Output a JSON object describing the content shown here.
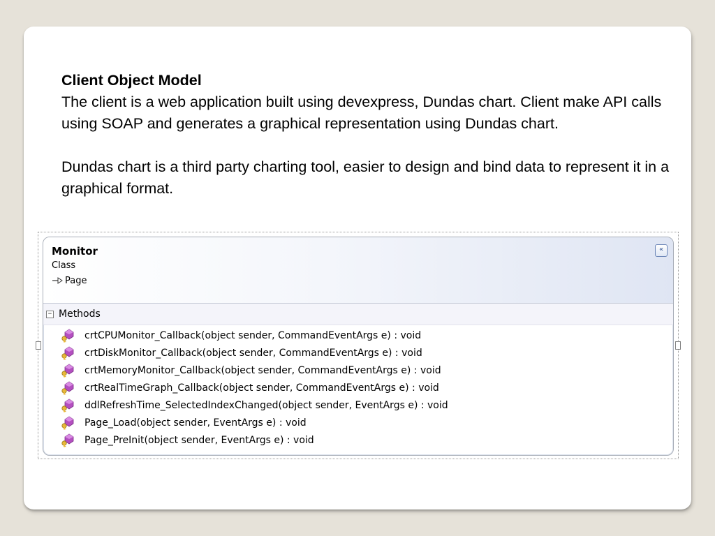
{
  "slide": {
    "heading": "Client Object Model",
    "paragraph1": "The client is a web application built using devexpress, Dundas chart. Client make API calls using SOAP and generates a graphical representation using Dundas chart.",
    "paragraph2": "Dundas chart is a third party charting tool, easier to design and bind data to represent it in a graphical format."
  },
  "diagram": {
    "class_name": "Monitor",
    "class_kind": "Class",
    "base_class": "Page",
    "collapse_glyph": "«",
    "section_label": "Methods",
    "methods": [
      "crtCPUMonitor_Callback(object sender, CommandEventArgs e) : void",
      "crtDiskMonitor_Callback(object sender, CommandEventArgs e) : void",
      "crtMemoryMonitor_Callback(object sender, CommandEventArgs e) : void",
      "crtRealTimeGraph_Callback(object sender, CommandEventArgs e) : void",
      "ddlRefreshTime_SelectedIndexChanged(object sender, EventArgs e) : void",
      "Page_Load(object sender, EventArgs e) : void",
      "Page_PreInit(object sender, EventArgs e) : void"
    ],
    "method_icon": "protected-method-icon"
  },
  "colors": {
    "background": "#e6e2d9",
    "method_icon": "#b44fc0",
    "key_icon": "#e8b83a"
  }
}
